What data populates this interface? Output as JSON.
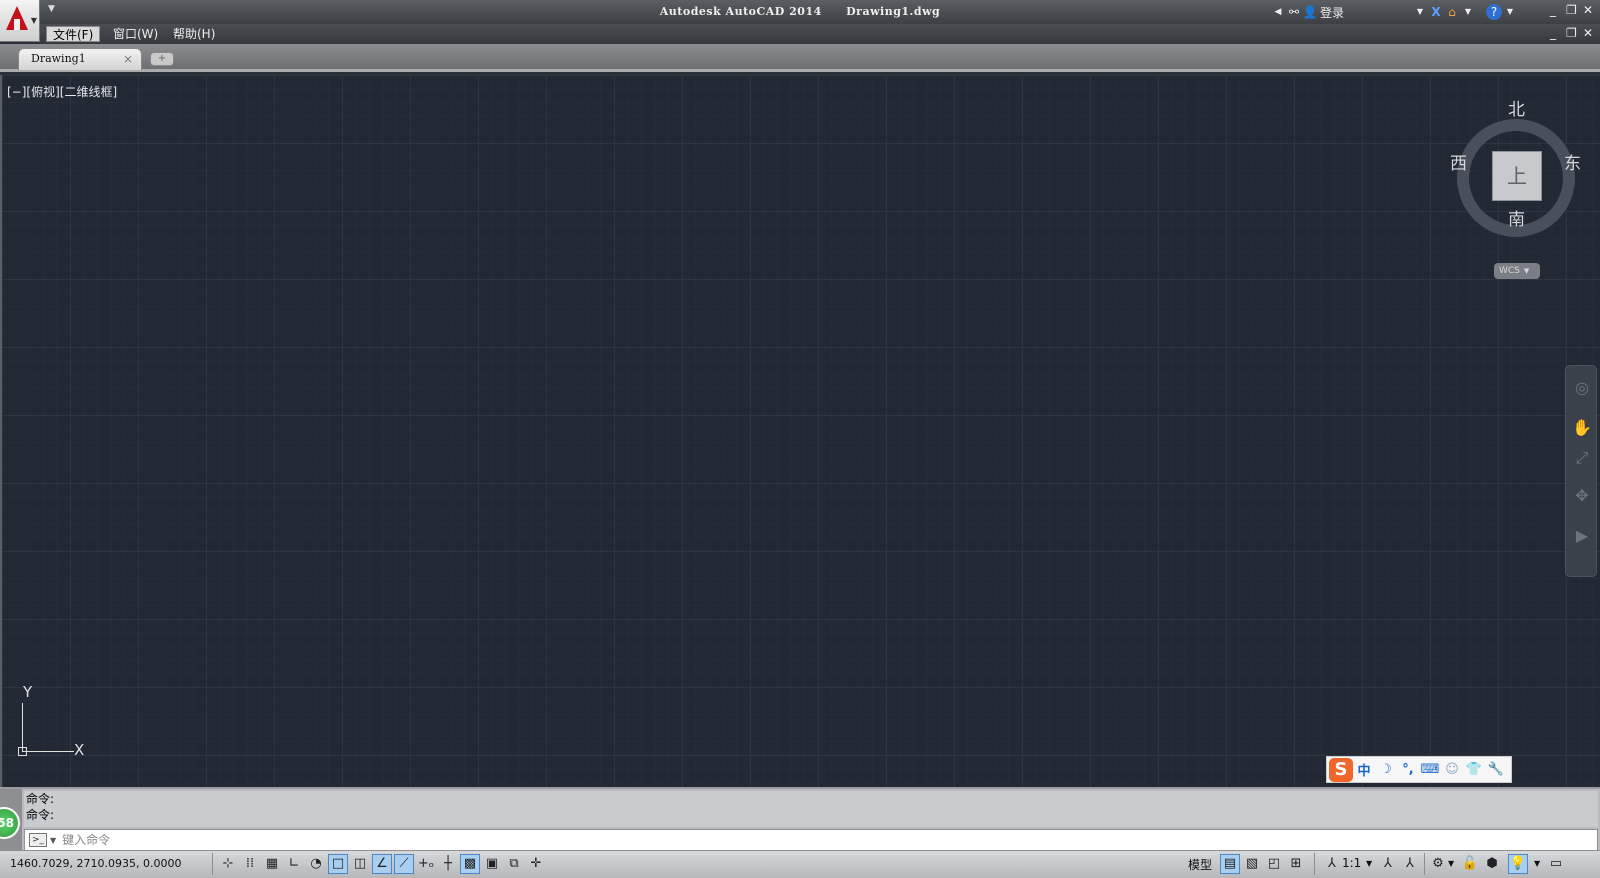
{
  "window": {
    "app_title": "Autodesk AutoCAD 2014",
    "file_title": "Drawing1.dwg",
    "signin_label": "登录",
    "help_icon": "help-icon"
  },
  "menu": {
    "items": [
      {
        "label": "文件(F)",
        "active": true
      },
      {
        "label": "窗口(W)",
        "active": false
      },
      {
        "label": "帮助(H)",
        "active": false
      }
    ]
  },
  "tabs": {
    "items": [
      {
        "label": "Drawing1"
      }
    ],
    "close_glyph": "×"
  },
  "viewport": {
    "label": "[−][俯视][二维线框]",
    "viewcube": {
      "north": "北",
      "south": "南",
      "east": "东",
      "west": "西",
      "face": "上",
      "wcs": "WCS"
    },
    "ucs": {
      "x": "X",
      "y": "Y"
    }
  },
  "ime": {
    "mode": "中"
  },
  "command": {
    "history": [
      "命令:",
      "命令:"
    ],
    "placeholder": "键入命令"
  },
  "badge": {
    "value": "58"
  },
  "status": {
    "coordinates": "1460.7029, 2710.0935, 0.0000",
    "model_label": "模型",
    "annotation_scale": "1:1"
  },
  "colors": {
    "canvas_bg": "#222834",
    "logo_red": "#c1121b",
    "status_toggle_on": "#a8cff0"
  }
}
